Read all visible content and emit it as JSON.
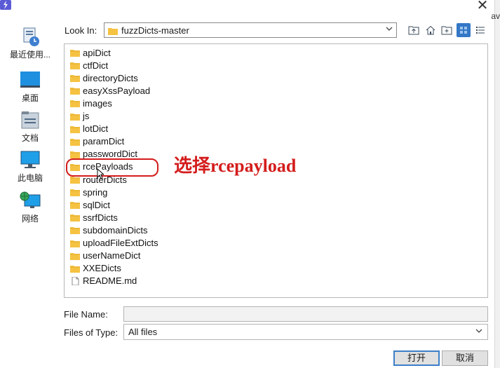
{
  "window": {
    "close_glyph": "✕",
    "edge_letter": "av"
  },
  "sidebar": {
    "items": [
      {
        "label": "最近使用...",
        "icon": "recent-icon"
      },
      {
        "label": "桌面",
        "icon": "desktop-icon"
      },
      {
        "label": "文档",
        "icon": "documents-icon"
      },
      {
        "label": "此电脑",
        "icon": "computer-icon"
      },
      {
        "label": "网络",
        "icon": "network-icon"
      }
    ]
  },
  "lookin": {
    "label": "Look In:",
    "value": "fuzzDicts-master"
  },
  "toolbar": {
    "icons": [
      "up-folder-icon",
      "home-icon",
      "new-folder-icon",
      "list-view-icon",
      "details-view-icon"
    ]
  },
  "files": [
    {
      "name": "apiDict",
      "type": "folder"
    },
    {
      "name": "ctfDict",
      "type": "folder"
    },
    {
      "name": "directoryDicts",
      "type": "folder"
    },
    {
      "name": "easyXssPayload",
      "type": "folder"
    },
    {
      "name": "images",
      "type": "folder"
    },
    {
      "name": "js",
      "type": "folder"
    },
    {
      "name": "lotDict",
      "type": "folder"
    },
    {
      "name": "paramDict",
      "type": "folder"
    },
    {
      "name": "passwordDict",
      "type": "folder"
    },
    {
      "name": "rcePayloads",
      "type": "folder"
    },
    {
      "name": "routerDicts",
      "type": "folder"
    },
    {
      "name": "spring",
      "type": "folder"
    },
    {
      "name": "sqlDict",
      "type": "folder"
    },
    {
      "name": "ssrfDicts",
      "type": "folder"
    },
    {
      "name": "subdomainDicts",
      "type": "folder"
    },
    {
      "name": "uploadFileExtDicts",
      "type": "folder"
    },
    {
      "name": "userNameDict",
      "type": "folder"
    },
    {
      "name": "XXEDicts",
      "type": "folder"
    },
    {
      "name": "README.md",
      "type": "file"
    }
  ],
  "annotation": {
    "text": "选择rcepayload"
  },
  "filename": {
    "label": "File Name:",
    "value": ""
  },
  "filetype": {
    "label": "Files of Type:",
    "value": "All files"
  },
  "buttons": {
    "open": "打开",
    "cancel": "取消"
  },
  "colors": {
    "folder": "#f5c242",
    "accent": "#3478c6",
    "annotation": "#d41c1c"
  }
}
